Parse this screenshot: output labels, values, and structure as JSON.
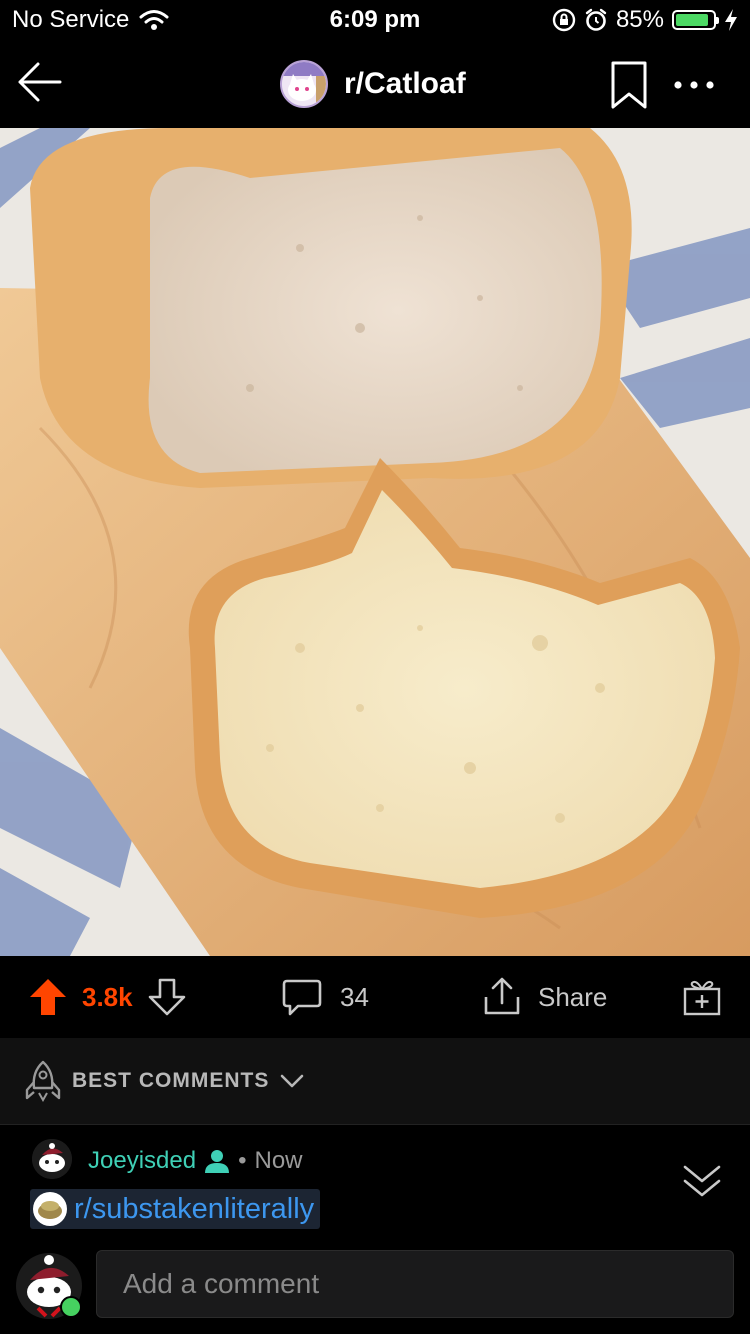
{
  "status_bar": {
    "carrier": "No Service",
    "time": "6:09 pm",
    "battery_percent": "85%",
    "battery_level": 0.85,
    "icons": [
      "wifi-icon",
      "orientation-lock-icon",
      "alarm-icon",
      "battery-icon",
      "charging-bolt-icon"
    ]
  },
  "nav": {
    "title": "r/Catloaf",
    "icons": [
      "back-arrow-icon",
      "bookmark-icon",
      "more-options-icon"
    ]
  },
  "post": {
    "image_subject": "cat-shaped bread loaf on wooden cutting board"
  },
  "actions": {
    "vote_count": "3.8k",
    "comment_count": "34",
    "share_label": "Share",
    "accent": "#ff4500",
    "icons": [
      "upvote-icon",
      "downvote-icon",
      "comment-icon",
      "share-icon",
      "award-icon"
    ]
  },
  "sort": {
    "label": "BEST COMMENTS",
    "icons": [
      "rocket-icon",
      "chevron-down-icon"
    ]
  },
  "comment": {
    "username": "Joeyisded",
    "separator": "•",
    "time": "Now",
    "body": "r/substakenliterally",
    "username_color": "#3fd0b6",
    "link_color": "#3d97ef"
  },
  "composer": {
    "placeholder": "Add a comment"
  }
}
